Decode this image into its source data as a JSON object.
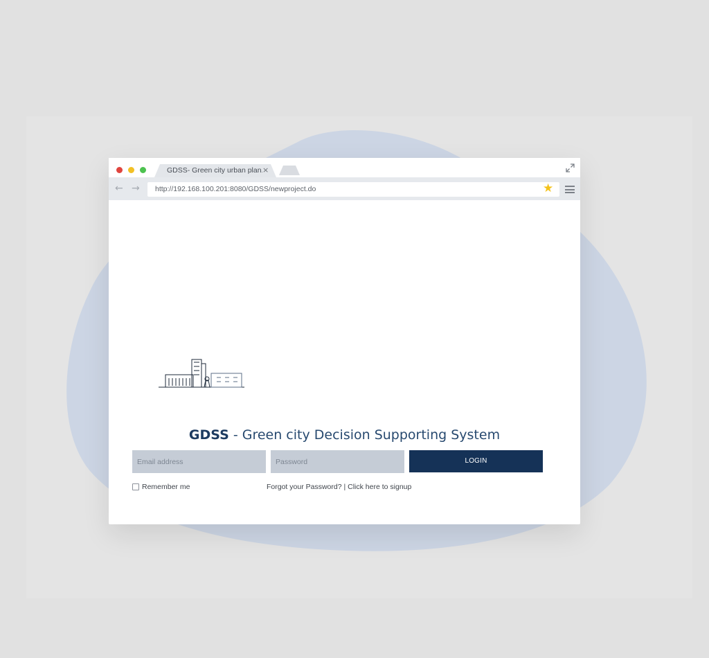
{
  "browser": {
    "tab_title": "GDSS- Green city urban plan...",
    "tab_close": "×",
    "url": "http://192.168.100.201:8080/GDSS/newproject.do",
    "icons": [
      "back-arrow-icon",
      "forward-arrow-icon",
      "star-icon",
      "menu-icon",
      "expand-icon"
    ],
    "traffic_light_colors": [
      "#e0443e",
      "#f2c025",
      "#4cc24f"
    ],
    "back_glyph": "←",
    "forward_glyph": "→",
    "star_glyph": "★"
  },
  "login": {
    "brand": "GDSS",
    "subtitle": " - Green city Decision Supporting System",
    "email_placeholder": "Email address",
    "password_placeholder": "Password",
    "login_label": "LOGIN",
    "remember_label": "Remember me",
    "forgot_label": "Forgot your Password?",
    "separator": " | ",
    "signup_label": "Click here to signup"
  },
  "colors": {
    "accent": "#153257",
    "heading": "#27496f",
    "input_background": "#c5ccd6",
    "blob": "#ccd5e4"
  }
}
